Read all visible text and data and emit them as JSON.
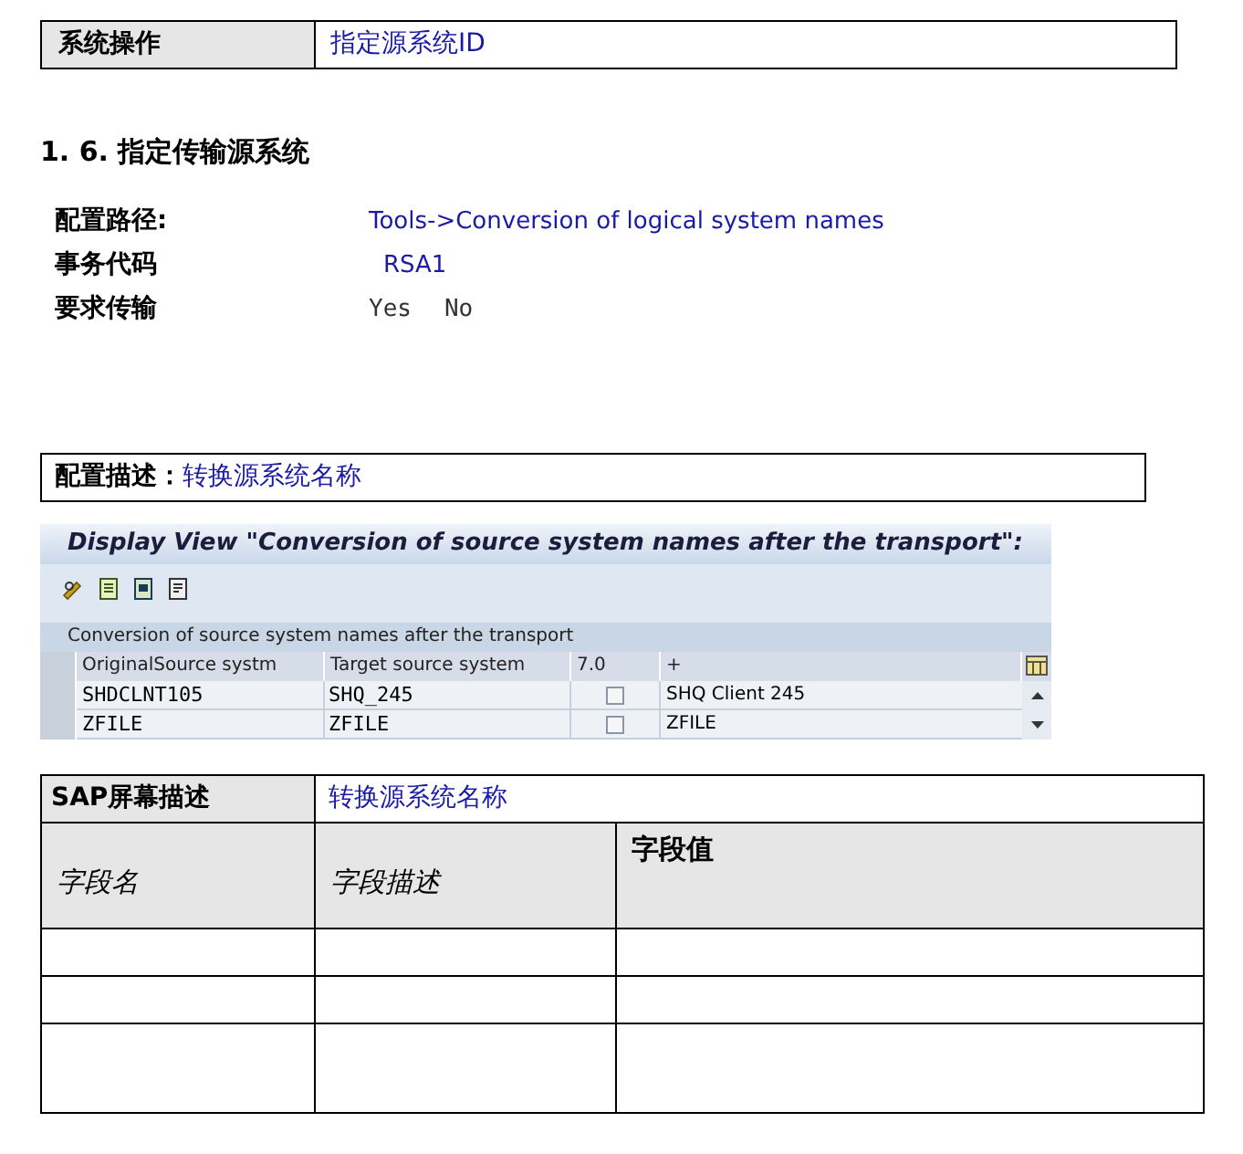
{
  "operation_table": {
    "label": "系统操作",
    "value": "指定源系统ID"
  },
  "heading": "1. 6. 指定传输源系统",
  "config_rows": [
    {
      "label": "配置路径:",
      "value": "Tools->Conversion of logical system names",
      "kind": "link"
    },
    {
      "label": "事务代码",
      "value": "RSA1",
      "kind": "link"
    },
    {
      "label": "要求传输",
      "kind": "options",
      "options": [
        "Yes",
        "No"
      ]
    }
  ],
  "config_description": {
    "label": "配置描述：",
    "value": "转换源系统名称"
  },
  "sap_screen": {
    "title": "Display View \"Conversion of source system names after the transport\":",
    "table_title": "Conversion of source system names after the transport",
    "columns": [
      "OriginalSource systm",
      "Target source system",
      "7.0",
      "+"
    ],
    "rows": [
      {
        "original": "SHDCLNT105",
        "target": "SHQ_245",
        "checked": false,
        "description": "SHQ Client 245"
      },
      {
        "original": "ZFILE",
        "target": "ZFILE",
        "checked": false,
        "description": "ZFILE"
      }
    ]
  },
  "screen_table": {
    "label": "SAP屏幕描述",
    "value": "转换源系统名称",
    "columns": [
      "字段名",
      "字段描述",
      "字段值"
    ]
  }
}
